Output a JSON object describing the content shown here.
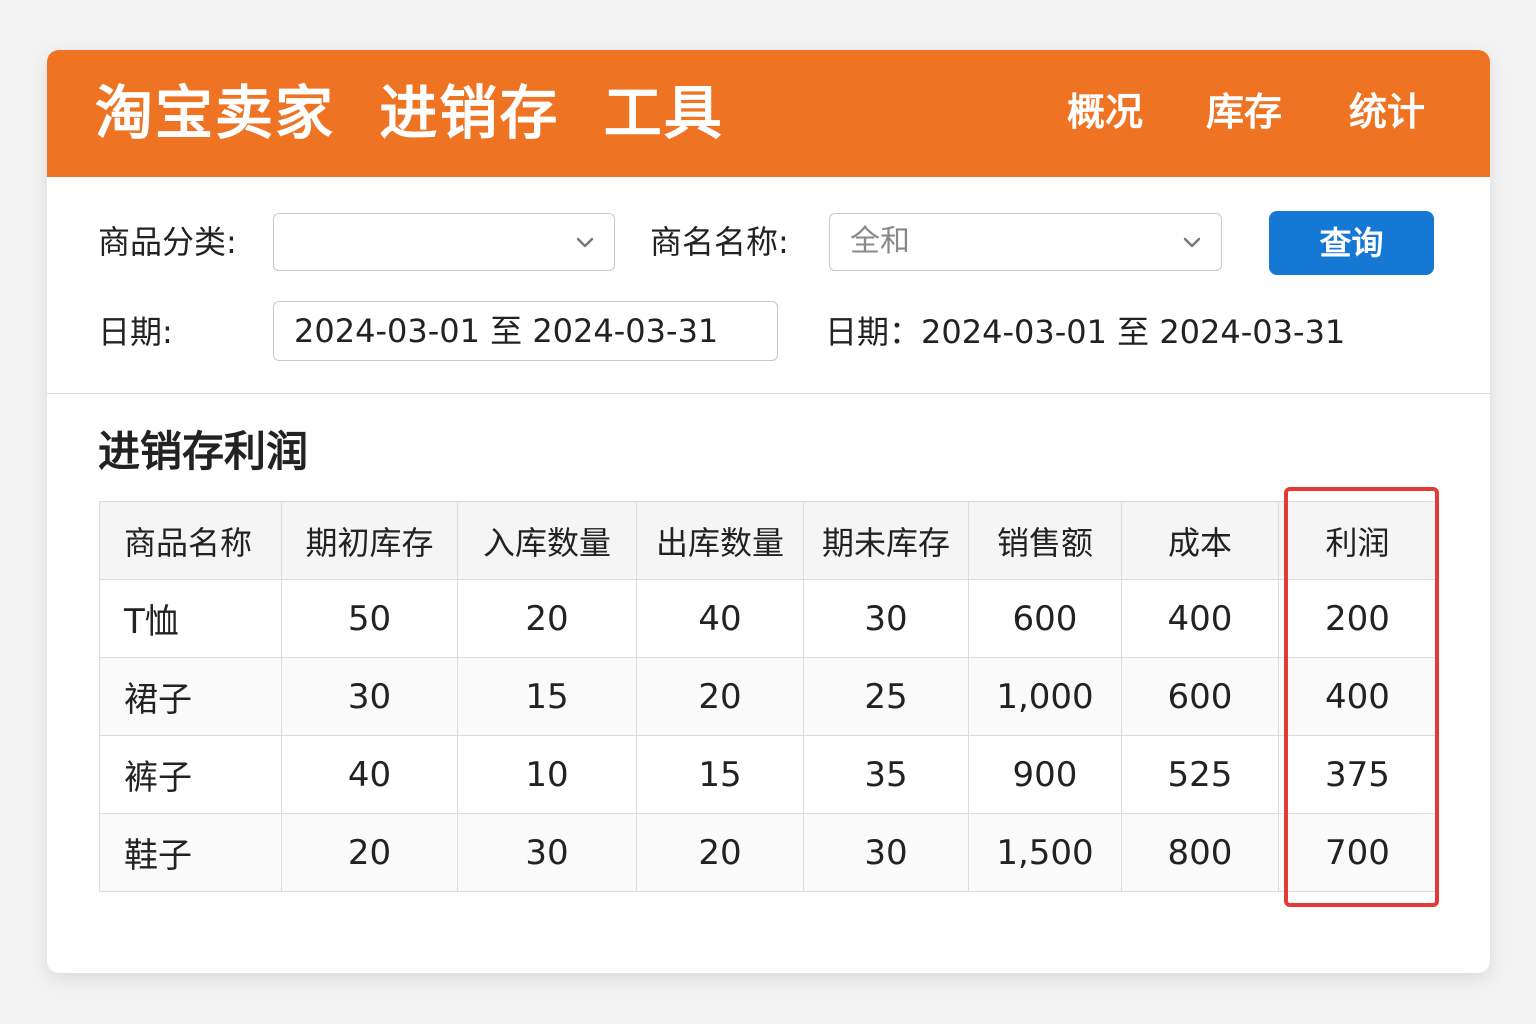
{
  "header": {
    "title": "淘宝卖家  进销存  工具",
    "nav": [
      "概况",
      "库存",
      "统计"
    ]
  },
  "filters": {
    "category_label": "商品分类:",
    "category_value": "",
    "product_label": "商名名称:",
    "product_value": "全和",
    "query_button": "查询",
    "date_label": "日期:",
    "date_value": "2024-03-01 至 2024-03-31",
    "date_display": "日期：2024-03-01 至 2024-03-31"
  },
  "report": {
    "title": "进销存利润",
    "columns": [
      "商品名称",
      "期初库存",
      "入库数量",
      "出库数量",
      "期未库存",
      "销售额",
      "成本",
      "利润"
    ],
    "rows": [
      [
        "T恤",
        "50",
        "20",
        "40",
        "30",
        "600",
        "400",
        "200"
      ],
      [
        "裙子",
        "30",
        "15",
        "20",
        "25",
        "1,000",
        "600",
        "400"
      ],
      [
        "裤子",
        "40",
        "10",
        "15",
        "35",
        "900",
        "525",
        "375"
      ],
      [
        "鞋子",
        "20",
        "30",
        "20",
        "30",
        "1,500",
        "800",
        "700"
      ]
    ]
  },
  "colors": {
    "header_bg": "#ee7424",
    "button_bg": "#1478d4",
    "highlight": "#e53935"
  }
}
